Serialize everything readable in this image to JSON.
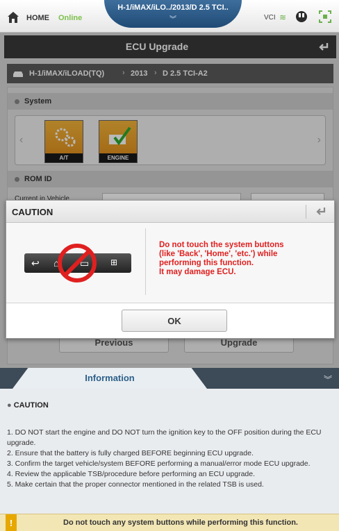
{
  "topbar": {
    "home_label": "HOME",
    "status_label": "Online",
    "path_text": "H-1/iMAX/iLO../2013/D 2.5 TCI..",
    "vci_label": "VCI",
    "icons": [
      "home-icon",
      "wifi-icon",
      "plug-icon",
      "scan-icon"
    ]
  },
  "titlebar": {
    "title": "ECU Upgrade"
  },
  "breadcrumb": {
    "items": [
      "H-1/iMAX/iLOAD(TQ)",
      "2013",
      "D 2.5 TCI-A2"
    ]
  },
  "system": {
    "header": "System",
    "tiles": [
      {
        "label": "A/T",
        "icon": "gears-icon"
      },
      {
        "label": "ENGINE",
        "icon": "engine-check-icon"
      }
    ]
  },
  "rom": {
    "header": "ROM ID",
    "current_label": "Current in Vehicle"
  },
  "buttons": {
    "previous": "Previous",
    "upgrade": "Upgrade"
  },
  "dialog": {
    "title": "CAUTION",
    "message_lines": [
      "Do not touch the system buttons",
      "(like 'Back', 'Home', 'etc.') while",
      "performing this function.",
      "It may damage ECU."
    ],
    "ok_label": "OK"
  },
  "info": {
    "tab_label": "Information",
    "section_title": "CAUTION",
    "items": [
      "1. DO NOT start the engine and DO NOT turn the ignition key to the OFF position during the ECU upgrade.",
      "2. Ensure that the battery is fully charged BEFORE beginning ECU upgrade.",
      "3. Confirm the target vehicle/system BEFORE performing a manual/error mode ECU upgrade.",
      "4. Review the applicable TSB/procedure before performing an ECU upgrade.",
      "5. Make certain that the proper connector mentioned in the related TSB is used."
    ]
  },
  "warning": {
    "icon": "!",
    "text": "Do not touch any system buttons while performing this function."
  },
  "colors": {
    "accent": "#2c5f8a",
    "caution_red": "#e02020",
    "online_green": "#7cc04b",
    "warn_yellow": "#e6a800"
  }
}
